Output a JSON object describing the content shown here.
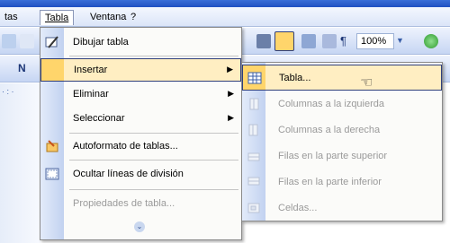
{
  "menubar": {
    "items": [
      {
        "label": "tas"
      },
      {
        "label": "Tabla"
      },
      {
        "label": "Ventana"
      },
      {
        "label": "?"
      }
    ]
  },
  "toolbar": {
    "zoom": "100%",
    "ruler_text": "· : ·"
  },
  "tabla_menu": {
    "items": [
      {
        "label": "Dibujar tabla",
        "icon": "pencil-icon",
        "has_submenu": false,
        "enabled": true
      },
      {
        "label": "Insertar",
        "icon": "",
        "has_submenu": true,
        "enabled": true,
        "highlighted": true
      },
      {
        "label": "Eliminar",
        "icon": "",
        "has_submenu": true,
        "enabled": true
      },
      {
        "label": "Seleccionar",
        "icon": "",
        "has_submenu": true,
        "enabled": true
      },
      {
        "label": "Autoformato de tablas...",
        "icon": "autoformat-icon",
        "has_submenu": false,
        "enabled": true
      },
      {
        "label": "Ocultar líneas de división",
        "icon": "gridlines-icon",
        "has_submenu": false,
        "enabled": true
      },
      {
        "label": "Propiedades de tabla...",
        "icon": "",
        "has_submenu": false,
        "enabled": false
      }
    ]
  },
  "insertar_submenu": {
    "items": [
      {
        "label": "Tabla...",
        "icon": "table-icon",
        "enabled": true,
        "highlighted": true
      },
      {
        "label": "Columnas a la izquierda",
        "icon": "insert-columns-left-icon",
        "enabled": false
      },
      {
        "label": "Columnas a la derecha",
        "icon": "insert-columns-right-icon",
        "enabled": false
      },
      {
        "label": "Filas en la parte superior",
        "icon": "insert-rows-above-icon",
        "enabled": false
      },
      {
        "label": "Filas en la parte inferior",
        "icon": "insert-rows-below-icon",
        "enabled": false
      },
      {
        "label": "Celdas...",
        "icon": "insert-cells-icon",
        "enabled": false
      }
    ]
  },
  "colors": {
    "highlight": "#ffeec2",
    "highlight_border": "#2f3f7c",
    "gutter": "#c2d2f0",
    "disabled_text": "#9a9a9a"
  }
}
